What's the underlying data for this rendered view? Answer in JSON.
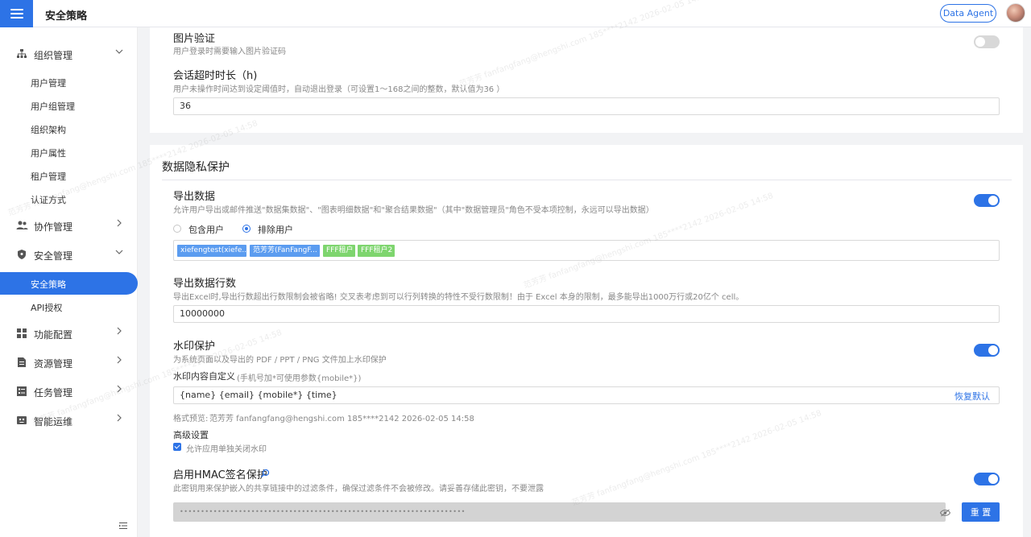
{
  "header": {
    "title": "安全策略",
    "agent_button": "Data Agent"
  },
  "sidebar": {
    "groups": [
      {
        "label": "组织管理",
        "icon": "org-icon"
      },
      {
        "label": "协作管理",
        "icon": "users-icon"
      },
      {
        "label": "安全管理",
        "icon": "shield-icon"
      },
      {
        "label": "功能配置",
        "icon": "grid-icon"
      },
      {
        "label": "资源管理",
        "icon": "file-icon"
      },
      {
        "label": "任务管理",
        "icon": "task-icon"
      },
      {
        "label": "智能运维",
        "icon": "robot-icon"
      }
    ],
    "org_items": [
      "用户管理",
      "用户组管理",
      "组织架构",
      "用户属性",
      "租户管理",
      "认证方式"
    ],
    "security_items": [
      "安全策略",
      "API授权"
    ]
  },
  "image_captcha": {
    "title": "图片验证",
    "desc": "用户登录时需要输入图片验证码",
    "enabled": false
  },
  "session_timeout": {
    "title": "会话超时时长（h)",
    "desc": "用户未操作时间达到设定阈值时，自动退出登录（可设置1～168之间的整数，默认值为36 ）",
    "value": "36"
  },
  "privacy": {
    "section_title": "数据隐私保护",
    "export": {
      "title": "导出数据",
      "desc": "允许用户导出或邮件推送\"数据集数据\"、\"图表明细数据\"和\"聚合结果数据\"（其中\"数据管理员\"角色不受本项控制，永远可以导出数据）",
      "enabled": true,
      "radio_include": "包含用户",
      "radio_exclude": "排除用户",
      "selected": "排除用户",
      "tags": [
        "xiefengtest(xiefe...",
        "范芳芳(FanFangF...",
        "FFF租户",
        "FFF租户2"
      ]
    },
    "export_rows": {
      "title": "导出数据行数",
      "desc": "导出Excel时,导出行数超出行数限制会被省略! 交叉表考虑到可以行列转换的特性不受行数限制！由于 Excel 本身的限制，最多能导出1000万行或20亿个 cell。",
      "value": "10000000"
    },
    "watermark": {
      "title": "水印保护",
      "desc": "为系统页面以及导出的 PDF / PPT / PNG 文件加上水印保护",
      "enabled": true,
      "custom_label": "水印内容自定义",
      "custom_hint": "(手机号加*可使用参数{mobile*})",
      "template": "{name} {email} {mobile*} {time}",
      "restore_default": "恢复默认",
      "preview_label": "格式预览:",
      "preview_value": "范芳芳 fanfangfang@hengshi.com 185****2142 2026-02-05 14:58",
      "advanced_title": "高级设置",
      "allow_app_disable": "允许应用单独关闭水印",
      "allow_app_disable_checked": true
    },
    "hmac": {
      "title": "启用HMAC签名保护",
      "desc": "此密钥用来保护嵌入的共享链接中的过滤条件，确保过滤条件不会被修改。请妥善存储此密钥，不要泄露",
      "enabled": true,
      "masked_value": "••••••••••••••••••••••••••••••••••••••••••••••••••••••••••••••••••••",
      "reset_label": "重 置"
    }
  },
  "watermark_overlay": "范芳芳 fanfangfang@hengshi.com 185****2142 2026-02-05 14:58"
}
